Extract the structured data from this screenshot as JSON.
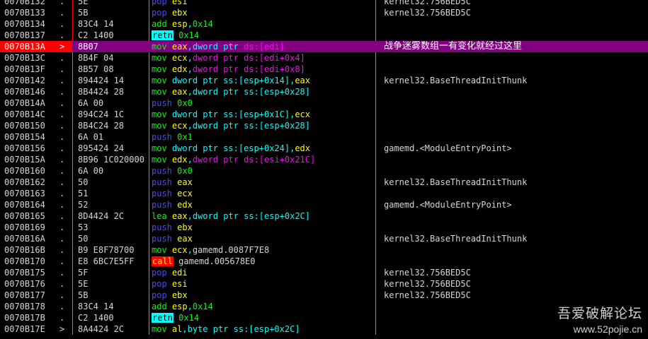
{
  "rows": [
    {
      "addr": "0070B132",
      "mark": ".",
      "bytes": "5E",
      "cmt": "kernel32.756BED5C",
      "asm": [
        {
          "t": "mnp",
          "v": "pop"
        },
        {
          "t": "sp",
          "v": " "
        },
        {
          "t": "reg",
          "v": "esi"
        }
      ]
    },
    {
      "addr": "0070B133",
      "mark": ".",
      "bytes": "5B",
      "cmt": "kernel32.756BED5C",
      "asm": [
        {
          "t": "mnp",
          "v": "pop"
        },
        {
          "t": "sp",
          "v": " "
        },
        {
          "t": "reg",
          "v": "ebx"
        }
      ]
    },
    {
      "addr": "0070B134",
      "mark": ".",
      "bytes": "83C4 14",
      "cmt": "",
      "asm": [
        {
          "t": "mn",
          "v": "add"
        },
        {
          "t": "sp",
          "v": " "
        },
        {
          "t": "reg",
          "v": "esp"
        },
        {
          "t": "op",
          "v": ","
        },
        {
          "t": "num",
          "v": "0x14"
        }
      ]
    },
    {
      "addr": "0070B137",
      "mark": ".",
      "bytes": "C2 1400",
      "cmt": "",
      "asm": [
        {
          "t": "retn",
          "v": "retn"
        },
        {
          "t": "sp",
          "v": " "
        },
        {
          "t": "num",
          "v": "0x14"
        }
      ]
    },
    {
      "addr": "0070B13A",
      "mark": ">",
      "bytes": "8B07",
      "cmt": "战争迷雾数组一有变化就经过这里",
      "sel": true,
      "asm": [
        {
          "t": "mn",
          "v": "mov"
        },
        {
          "t": "sp",
          "v": " "
        },
        {
          "t": "reg",
          "v": "eax"
        },
        {
          "t": "op",
          "v": ","
        },
        {
          "t": "op",
          "v": "dword ptr "
        },
        {
          "t": "mem",
          "v": "ds:[edi]"
        }
      ]
    },
    {
      "addr": "0070B13C",
      "mark": ".",
      "bytes": "8B4F 04",
      "cmt": "",
      "asm": [
        {
          "t": "mn",
          "v": "mov"
        },
        {
          "t": "sp",
          "v": " "
        },
        {
          "t": "reg",
          "v": "ecx"
        },
        {
          "t": "op",
          "v": ","
        },
        {
          "t": "mem",
          "v": "dword ptr ds:[edi+0x4]"
        }
      ]
    },
    {
      "addr": "0070B13F",
      "mark": ".",
      "bytes": "8B57 08",
      "cmt": "",
      "asm": [
        {
          "t": "mn",
          "v": "mov"
        },
        {
          "t": "sp",
          "v": " "
        },
        {
          "t": "reg",
          "v": "edx"
        },
        {
          "t": "op",
          "v": ","
        },
        {
          "t": "mem",
          "v": "dword ptr ds:[edi+0x8]"
        }
      ]
    },
    {
      "addr": "0070B142",
      "mark": ".",
      "bytes": "894424 14",
      "cmt": "kernel32.BaseThreadInitThunk",
      "asm": [
        {
          "t": "mn",
          "v": "mov"
        },
        {
          "t": "sp",
          "v": " "
        },
        {
          "t": "op",
          "v": "dword ptr ss:[esp+0x14]"
        },
        {
          "t": "op",
          "v": ","
        },
        {
          "t": "reg",
          "v": "eax"
        }
      ]
    },
    {
      "addr": "0070B146",
      "mark": ".",
      "bytes": "8B4424 28",
      "cmt": "",
      "asm": [
        {
          "t": "mn",
          "v": "mov"
        },
        {
          "t": "sp",
          "v": " "
        },
        {
          "t": "reg",
          "v": "eax"
        },
        {
          "t": "op",
          "v": ","
        },
        {
          "t": "op",
          "v": "dword ptr ss:[esp+0x28]"
        }
      ]
    },
    {
      "addr": "0070B14A",
      "mark": ".",
      "bytes": "6A 00",
      "cmt": "",
      "asm": [
        {
          "t": "mnp",
          "v": "push"
        },
        {
          "t": "sp",
          "v": " "
        },
        {
          "t": "num",
          "v": "0x0"
        }
      ]
    },
    {
      "addr": "0070B14C",
      "mark": ".",
      "bytes": "894C24 1C",
      "cmt": "",
      "asm": [
        {
          "t": "mn",
          "v": "mov"
        },
        {
          "t": "sp",
          "v": " "
        },
        {
          "t": "op",
          "v": "dword ptr ss:[esp+0x1C]"
        },
        {
          "t": "op",
          "v": ","
        },
        {
          "t": "reg",
          "v": "ecx"
        }
      ]
    },
    {
      "addr": "0070B150",
      "mark": ".",
      "bytes": "8B4C24 28",
      "cmt": "",
      "asm": [
        {
          "t": "mn",
          "v": "mov"
        },
        {
          "t": "sp",
          "v": " "
        },
        {
          "t": "reg",
          "v": "ecx"
        },
        {
          "t": "op",
          "v": ","
        },
        {
          "t": "op",
          "v": "dword ptr ss:[esp+0x28]"
        }
      ]
    },
    {
      "addr": "0070B154",
      "mark": ".",
      "bytes": "6A 01",
      "cmt": "",
      "asm": [
        {
          "t": "mnp",
          "v": "push"
        },
        {
          "t": "sp",
          "v": " "
        },
        {
          "t": "num",
          "v": "0x1"
        }
      ]
    },
    {
      "addr": "0070B156",
      "mark": ".",
      "bytes": "895424 24",
      "cmt": "gamemd.<ModuleEntryPoint>",
      "asm": [
        {
          "t": "mn",
          "v": "mov"
        },
        {
          "t": "sp",
          "v": " "
        },
        {
          "t": "op",
          "v": "dword ptr ss:[esp+0x24]"
        },
        {
          "t": "op",
          "v": ","
        },
        {
          "t": "reg",
          "v": "edx"
        }
      ]
    },
    {
      "addr": "0070B15A",
      "mark": ".",
      "bytes": "8B96 1C020000",
      "cmt": "",
      "asm": [
        {
          "t": "mn",
          "v": "mov"
        },
        {
          "t": "sp",
          "v": " "
        },
        {
          "t": "reg",
          "v": "edx"
        },
        {
          "t": "op",
          "v": ","
        },
        {
          "t": "mem",
          "v": "dword ptr ds:[esi+0x21C]"
        }
      ]
    },
    {
      "addr": "0070B160",
      "mark": ".",
      "bytes": "6A 00",
      "cmt": "",
      "asm": [
        {
          "t": "mnp",
          "v": "push"
        },
        {
          "t": "sp",
          "v": " "
        },
        {
          "t": "num",
          "v": "0x0"
        }
      ]
    },
    {
      "addr": "0070B162",
      "mark": ".",
      "bytes": "50",
      "cmt": "kernel32.BaseThreadInitThunk",
      "asm": [
        {
          "t": "mnp",
          "v": "push"
        },
        {
          "t": "sp",
          "v": " "
        },
        {
          "t": "reg",
          "v": "eax"
        }
      ]
    },
    {
      "addr": "0070B163",
      "mark": ".",
      "bytes": "51",
      "cmt": "",
      "asm": [
        {
          "t": "mnp",
          "v": "push"
        },
        {
          "t": "sp",
          "v": " "
        },
        {
          "t": "reg",
          "v": "ecx"
        }
      ]
    },
    {
      "addr": "0070B164",
      "mark": ".",
      "bytes": "52",
      "cmt": "gamemd.<ModuleEntryPoint>",
      "asm": [
        {
          "t": "mnp",
          "v": "push"
        },
        {
          "t": "sp",
          "v": " "
        },
        {
          "t": "reg",
          "v": "edx"
        }
      ]
    },
    {
      "addr": "0070B165",
      "mark": ".",
      "bytes": "8D4424 2C",
      "cmt": "",
      "asm": [
        {
          "t": "mn",
          "v": "lea"
        },
        {
          "t": "sp",
          "v": " "
        },
        {
          "t": "reg",
          "v": "eax"
        },
        {
          "t": "op",
          "v": ","
        },
        {
          "t": "op",
          "v": "dword ptr ss:[esp+0x2C]"
        }
      ]
    },
    {
      "addr": "0070B169",
      "mark": ".",
      "bytes": "53",
      "cmt": "",
      "asm": [
        {
          "t": "mnp",
          "v": "push"
        },
        {
          "t": "sp",
          "v": " "
        },
        {
          "t": "reg",
          "v": "ebx"
        }
      ]
    },
    {
      "addr": "0070B16A",
      "mark": ".",
      "bytes": "50",
      "cmt": "kernel32.BaseThreadInitThunk",
      "asm": [
        {
          "t": "mnp",
          "v": "push"
        },
        {
          "t": "sp",
          "v": " "
        },
        {
          "t": "reg",
          "v": "eax"
        }
      ]
    },
    {
      "addr": "0070B16B",
      "mark": ".",
      "bytes": "B9 E8F78700",
      "cmt": "",
      "asm": [
        {
          "t": "mn",
          "v": "mov"
        },
        {
          "t": "sp",
          "v": " "
        },
        {
          "t": "reg",
          "v": "ecx"
        },
        {
          "t": "op",
          "v": ","
        },
        {
          "t": "lbl",
          "v": "gamemd.0087F7E8"
        }
      ]
    },
    {
      "addr": "0070B170",
      "mark": ".",
      "bytes": "E8 6BC7E5FF",
      "cmt": "",
      "asm": [
        {
          "t": "call",
          "v": "call"
        },
        {
          "t": "sp",
          "v": " "
        },
        {
          "t": "lbl",
          "v": "gamemd.005678E0"
        }
      ]
    },
    {
      "addr": "0070B175",
      "mark": ".",
      "bytes": "5F",
      "cmt": "kernel32.756BED5C",
      "asm": [
        {
          "t": "mnp",
          "v": "pop"
        },
        {
          "t": "sp",
          "v": " "
        },
        {
          "t": "reg",
          "v": "edi"
        }
      ]
    },
    {
      "addr": "0070B176",
      "mark": ".",
      "bytes": "5E",
      "cmt": "kernel32.756BED5C",
      "asm": [
        {
          "t": "mnp",
          "v": "pop"
        },
        {
          "t": "sp",
          "v": " "
        },
        {
          "t": "reg",
          "v": "esi"
        }
      ]
    },
    {
      "addr": "0070B177",
      "mark": ".",
      "bytes": "5B",
      "cmt": "kernel32.756BED5C",
      "asm": [
        {
          "t": "mnp",
          "v": "pop"
        },
        {
          "t": "sp",
          "v": " "
        },
        {
          "t": "reg",
          "v": "ebx"
        }
      ]
    },
    {
      "addr": "0070B178",
      "mark": ".",
      "bytes": "83C4 14",
      "cmt": "",
      "asm": [
        {
          "t": "mn",
          "v": "add"
        },
        {
          "t": "sp",
          "v": " "
        },
        {
          "t": "reg",
          "v": "esp"
        },
        {
          "t": "op",
          "v": ","
        },
        {
          "t": "num",
          "v": "0x14"
        }
      ]
    },
    {
      "addr": "0070B17B",
      "mark": ".",
      "bytes": "C2 1400",
      "cmt": "",
      "asm": [
        {
          "t": "retn",
          "v": "retn"
        },
        {
          "t": "sp",
          "v": " "
        },
        {
          "t": "num",
          "v": "0x14"
        }
      ]
    },
    {
      "addr": "0070B17E",
      "mark": ">",
      "bytes": "8A4424 2C",
      "cmt": "",
      "asm": [
        {
          "t": "mn",
          "v": "mov"
        },
        {
          "t": "sp",
          "v": " "
        },
        {
          "t": "reg",
          "v": "al"
        },
        {
          "t": "op",
          "v": ","
        },
        {
          "t": "op",
          "v": "byte ptr ss:[esp+0x2C]"
        }
      ]
    }
  ],
  "watermark": {
    "brand": "吾爱破解论坛",
    "url": "www.52pojie.cn"
  },
  "colors": {
    "background": "#000000",
    "selected_row": "#800080",
    "selected_addr": "#ff0000",
    "mnemonic": "#00ff00",
    "stack_mnemonic": "#4a4aff",
    "register": "#ffff00",
    "operand": "#00ffff",
    "memory_ds": "#ff00ff",
    "retn_highlight": "#00ffff",
    "call_highlight": "#ff0000"
  }
}
